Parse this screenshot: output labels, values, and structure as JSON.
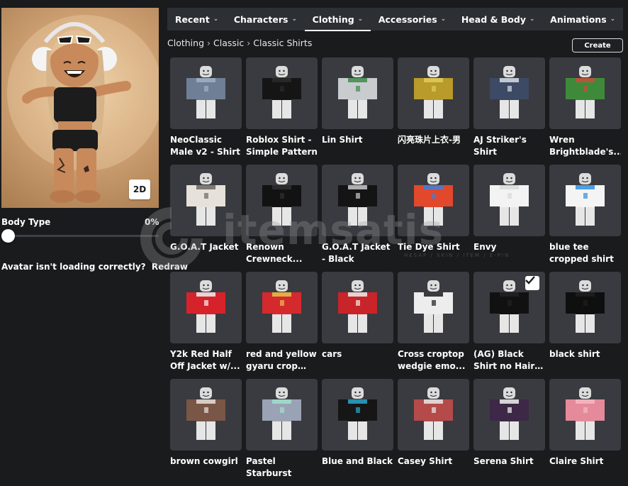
{
  "avatar": {
    "toggle_label": "2D",
    "body_type_label": "Body Type",
    "body_type_value": "0%",
    "body_type_fraction": 0,
    "loading_issue_text": "Avatar isn't loading correctly?",
    "redraw_label": "Redraw"
  },
  "tabs": [
    {
      "label": "Recent",
      "active": false
    },
    {
      "label": "Characters",
      "active": false
    },
    {
      "label": "Clothing",
      "active": true
    },
    {
      "label": "Accessories",
      "active": false
    },
    {
      "label": "Head & Body",
      "active": false
    },
    {
      "label": "Animations",
      "active": false
    }
  ],
  "breadcrumb": [
    "Clothing",
    "Classic",
    "Classic Shirts"
  ],
  "create_label": "Create",
  "items": [
    {
      "name": "NeoClassic Male v2 - Shirt",
      "top": "#6f7f95",
      "accent": "#9fb0c6",
      "equipped": false
    },
    {
      "name": "Roblox Shirt - Simple Pattern",
      "top": "#151515",
      "accent": "#2a2a2a",
      "equipped": false
    },
    {
      "name": "Lin Shirt",
      "top": "#c9cccf",
      "accent": "#3e8a49",
      "equipped": false
    },
    {
      "name": "闪亮珠片上衣-男",
      "top": "#b89b2a",
      "accent": "#e2cb5a",
      "equipped": false
    },
    {
      "name": "AJ Striker's Shirt",
      "top": "#3d4a66",
      "accent": "#d8dde6",
      "equipped": false
    },
    {
      "name": "Wren Brightblade's...",
      "top": "#3f8a3a",
      "accent": "#c84d3b",
      "equipped": false
    },
    {
      "name": "G.O.A.T Jacket",
      "top": "#e6e2d9",
      "accent": "#6a6860",
      "equipped": false
    },
    {
      "name": "Renown Crewneck...",
      "top": "#121212",
      "accent": "#303030",
      "equipped": false
    },
    {
      "name": "G.O.A.T Jacket - Black",
      "top": "#141414",
      "accent": "#c9c9c9",
      "equipped": false
    },
    {
      "name": "Tie Dye Shirt",
      "top": "#e2482c",
      "accent": "#3f7fd8",
      "equipped": false
    },
    {
      "name": "Envy",
      "top": "#f3f3f3",
      "accent": "#d9d9d9",
      "equipped": false
    },
    {
      "name": "blue tee cropped shirt",
      "top": "#f4f4f4",
      "accent": "#2f8ee0",
      "equipped": false
    },
    {
      "name": "Y2k Red Half Off Jacket w/...",
      "top": "#d6232b",
      "accent": "#f1f1f1",
      "equipped": false
    },
    {
      "name": "red and yellow gyaru crop top...",
      "top": "#d42a2d",
      "accent": "#e7c34a",
      "equipped": false
    },
    {
      "name": "cars",
      "top": "#c8242a",
      "accent": "#eeeeee",
      "equipped": false
    },
    {
      "name": "Cross croptop wedgie emo...",
      "top": "#ededed",
      "accent": "#1b1b1b",
      "equipped": false
    },
    {
      "name": "(AG) Black Shirt no Hair ext [co...",
      "top": "#111111",
      "accent": "#222222",
      "equipped": true
    },
    {
      "name": "black shirt",
      "top": "#0f0f0f",
      "accent": "#1f1f1f",
      "equipped": false
    },
    {
      "name": "brown cowgirl",
      "top": "#7a5646",
      "accent": "#e8e1dc",
      "equipped": false
    },
    {
      "name": "Pastel Starburst",
      "top": "#9aa3b5",
      "accent": "#9fe0cd",
      "equipped": false
    },
    {
      "name": "Blue and Black",
      "top": "#161616",
      "accent": "#2aa7c9",
      "equipped": false
    },
    {
      "name": "Casey Shirt",
      "top": "#b44a4a",
      "accent": "#e9e9e9",
      "equipped": false
    },
    {
      "name": "Serena Shirt",
      "top": "#3d2848",
      "accent": "#f2f2f2",
      "equipped": false
    },
    {
      "name": "Claire Shirt",
      "top": "#e58a9a",
      "accent": "#f3b9c4",
      "equipped": false
    }
  ],
  "watermark": {
    "text": "itemsatis",
    "subtext": "HESAP / SKIN / ITEM / E-PIN"
  }
}
